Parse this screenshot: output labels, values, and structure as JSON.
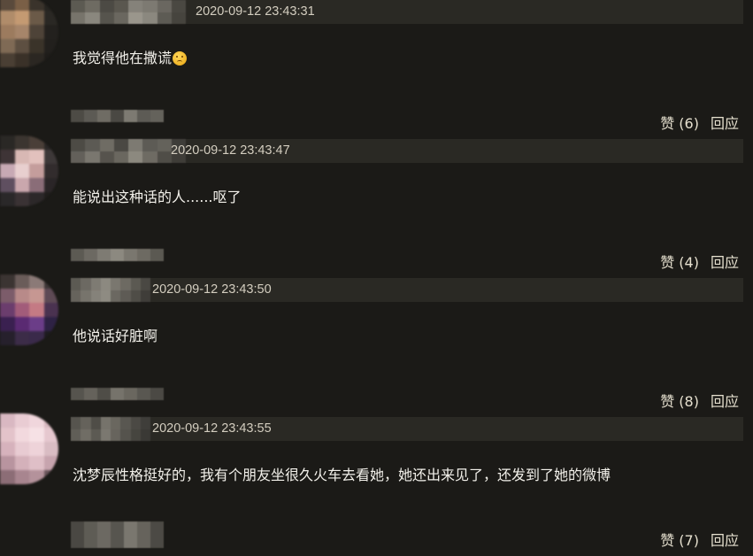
{
  "comments": [
    {
      "timestamp": "2020-09-12 23:43:31",
      "text": "我觉得他在撒谎",
      "emoji_icon": "confused-face-icon",
      "like_label": "赞 (6)",
      "reply_label": "回应",
      "avatar_colors": [
        "#5a4a3c",
        "#7a5f46",
        "#3a332b",
        "#262420",
        "#b08c6a",
        "#c49a72",
        "#6b5a48",
        "#2a2824",
        "#9c7b5e",
        "#a6856a",
        "#4e4338",
        "#23211e",
        "#7f6a55",
        "#5d4f41",
        "#3a3329",
        "#22201d",
        "#4a3f34",
        "#3a3128",
        "#2b2722",
        "#1f1d1a"
      ],
      "username_colors": [
        "#5c5a52",
        "#6e6b62",
        "#4c4a44",
        "#5a574f",
        "#85827a",
        "#7d7a72",
        "#6a6760",
        "#4a4842",
        "#77746b",
        "#8a877e",
        "#56544d",
        "#6a675f",
        "#9a968c",
        "#8b887f",
        "#5d5b54",
        "#46443e"
      ]
    },
    {
      "timestamp": "2020-09-12 23:43:47",
      "text": "能说出这种话的人......呕了",
      "emoji_icon": "",
      "like_label": "赞 (4)",
      "reply_label": "回应",
      "avatar_colors": [
        "#2a2825",
        "#3b3530",
        "#4a3f38",
        "#2a2726",
        "#3e3436",
        "#d8b8b4",
        "#e2c1bd",
        "#3d3838",
        "#c7a9b4",
        "#e8cfcf",
        "#c49d9c",
        "#322c2d",
        "#5f4f60",
        "#caa7ad",
        "#8a6d78",
        "#2a2527",
        "#2a2829",
        "#3a3234",
        "#2c2829",
        "#201e1c"
      ],
      "username_colors": [
        "#4d4b45",
        "#5c5a54",
        "#6f6c64",
        "#4a4843",
        "#7d7a72",
        "#5d5b55",
        "#64625b",
        "#3e3d39",
        "#63605a",
        "#7a776f",
        "#56534d",
        "#6a675f",
        "#8c897f",
        "#6e6b63",
        "#4f4d47",
        "#3f3d38"
      ]
    },
    {
      "timestamp": "2020-09-12 23:43:50",
      "text": "他说话好脏啊",
      "emoji_icon": "",
      "like_label": "赞 (8)",
      "reply_label": "回应",
      "avatar_colors": [
        "#3b3432",
        "#6a5c59",
        "#8b7a77",
        "#3e3737",
        "#7c5c6a",
        "#b88a89",
        "#c69792",
        "#5e4a55",
        "#6b3d6d",
        "#a25c7a",
        "#c47a84",
        "#4a3250",
        "#3a2050",
        "#5a2a72",
        "#6b3d88",
        "#2e2244",
        "#26202c",
        "#3c2c48",
        "#3a2a4a",
        "#1e1c20"
      ],
      "username_colors": [
        "#5c5a53",
        "#6c6962",
        "#7e7b73",
        "#8c8980",
        "#7a776f",
        "#6d6a62",
        "#5b5952",
        "#4a4843",
        "#66635c",
        "#77746c",
        "#85827a",
        "#8e8b82",
        "#6b6861",
        "#5e5b55",
        "#4f4d47",
        "#3f3d39"
      ]
    },
    {
      "timestamp": "2020-09-12 23:43:55",
      "text": "沈梦辰性格挺好的，我有个朋友坐很久火车去看她，她还出来见了，还发到了她的微博",
      "emoji_icon": "",
      "like_label": "赞 (7)",
      "reply_label": "回应",
      "avatar_colors": [
        "#d9b8c2",
        "#e9ccd3",
        "#f0d6dc",
        "#d8b9c0",
        "#e3c3ca",
        "#f2d9de",
        "#f6e1e5",
        "#e6c8cf",
        "#d6b2bc",
        "#e8cbd2",
        "#eed3d9",
        "#d9bcc3",
        "#b8949f",
        "#d4b1ba",
        "#dfbfc7",
        "#c7a4ae",
        "#8c6d76",
        "#a8858f",
        "#b4929b",
        "#6a555b"
      ],
      "username_colors": [
        "#56544e",
        "#65625b",
        "#4f4d47",
        "#76736b",
        "#6a675f",
        "#595751",
        "#4b4944",
        "#3f3e3a",
        "#605e57",
        "#706d65",
        "#5c5a53",
        "#7b7870",
        "#67645d",
        "#55534d",
        "#46453f",
        "#3a3935"
      ]
    }
  ],
  "trailing_username_colors": [
    "#4a4843",
    "#5e5c55",
    "#6c6962",
    "#57554f",
    "#7a776f",
    "#66635c",
    "#4c4a45"
  ]
}
